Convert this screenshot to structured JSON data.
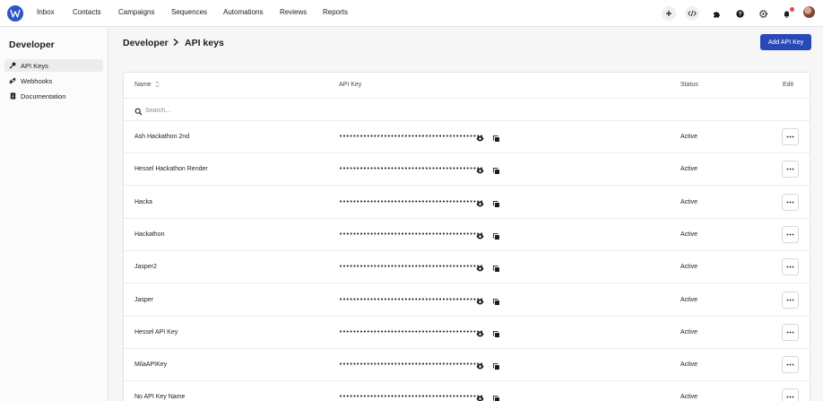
{
  "topnav": {
    "items": [
      "Inbox",
      "Contacts",
      "Campaigns",
      "Sequences",
      "Automations",
      "Reviews",
      "Reports"
    ],
    "icons": [
      "plus-icon",
      "code-icon",
      "puzzle-icon",
      "help-icon",
      "settings-icon",
      "bell-icon",
      "avatar"
    ]
  },
  "sidebar": {
    "title": "Developer",
    "items": [
      {
        "label": "API Keys",
        "icon": "key-icon",
        "active": true
      },
      {
        "label": "Webhooks",
        "icon": "webhook-icon",
        "active": false
      },
      {
        "label": "Documentation",
        "icon": "document-icon",
        "active": false
      }
    ]
  },
  "header": {
    "breadcrumb_parent": "Developer",
    "breadcrumb_current": "API keys",
    "add_button": "Add API Key"
  },
  "table": {
    "columns": {
      "name": "Name",
      "sort_icon": "sort-icon",
      "api_key": "API Key",
      "status": "Status",
      "edit": "Edit"
    },
    "search_placeholder": "Search...",
    "rows": [
      {
        "name": "Ash Hackathon 2nd",
        "key": "••••••••••••••••••••••••••••••••••••••••••",
        "status": "Active"
      },
      {
        "name": "Hessel Hackathon Render",
        "key": "••••••••••••••••••••••••••••••••••••••••••",
        "status": "Active"
      },
      {
        "name": "Hacka",
        "key": "••••••••••••••••••••••••••••••••••••••••••",
        "status": "Active"
      },
      {
        "name": "Hackathon",
        "key": "••••••••••••••••••••••••••••••••••••••••••",
        "status": "Active"
      },
      {
        "name": "Jasper2",
        "key": "••••••••••••••••••••••••••••••••••••••••••",
        "status": "Active"
      },
      {
        "name": "Jasper",
        "key": "••••••••••••••••••••••••••••••••••••••••••",
        "status": "Active"
      },
      {
        "name": "Hessel API Key",
        "key": "••••••••••••••••••••••••••••••••••••••••••",
        "status": "Active"
      },
      {
        "name": "MilaAPIKey",
        "key": "••••••••••••••••••••••••••••••••••••••••••",
        "status": "Active"
      },
      {
        "name": "No API Key Name",
        "key": "••••••••••••••••••••••••••••••••••••••••••",
        "status": "Active"
      }
    ]
  },
  "colors": {
    "accent": "#2a49b8",
    "logo": "#2f55c6",
    "notification": "#e5484d"
  }
}
